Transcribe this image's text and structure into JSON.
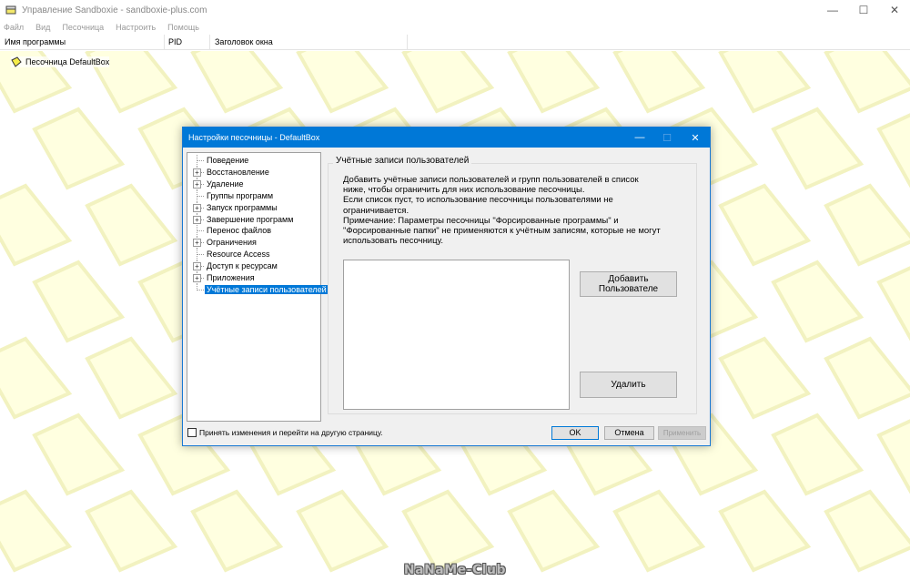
{
  "window": {
    "title": "Управление Sandboxie - sandboxie-plus.com",
    "minimize": "—",
    "maximize": "☐",
    "close": "✕"
  },
  "menu": [
    "Файл",
    "Вид",
    "Песочница",
    "Настроить",
    "Помощь"
  ],
  "columns": {
    "program_name": "Имя программы",
    "pid": "PID",
    "window_title": "Заголовок окна"
  },
  "sandbox": {
    "label": "Песочница DefaultBox"
  },
  "watermark": "NaNaMe-Club",
  "dialog": {
    "title": "Настройки песочницы - DefaultBox",
    "tree": [
      {
        "label": "Поведение",
        "expandable": false,
        "selected": false
      },
      {
        "label": "Восстановление",
        "expandable": true,
        "selected": false
      },
      {
        "label": "Удаление",
        "expandable": true,
        "selected": false
      },
      {
        "label": "Группы программ",
        "expandable": false,
        "selected": false
      },
      {
        "label": "Запуск программы",
        "expandable": true,
        "selected": false
      },
      {
        "label": "Завершение программ",
        "expandable": true,
        "selected": false
      },
      {
        "label": "Перенос файлов",
        "expandable": false,
        "selected": false
      },
      {
        "label": "Ограничения",
        "expandable": true,
        "selected": false
      },
      {
        "label": "Resource Access",
        "expandable": false,
        "selected": false
      },
      {
        "label": "Доступ к ресурсам",
        "expandable": true,
        "selected": false
      },
      {
        "label": "Приложения",
        "expandable": true,
        "selected": false
      },
      {
        "label": "Учётные записи пользователей",
        "expandable": false,
        "selected": true
      }
    ],
    "group_title": "Учётные записи пользователей",
    "description": [
      "Добавить учётные записи пользователей и групп пользователей в список",
      "ниже, чтобы ограничить для них использование песочницы.",
      "Если список пуст, то использование песочницы пользователями не",
      "ограничивается.",
      "Примечание: Параметры песочницы \"Форсированные программы\" и",
      "\"Форсированные папки\" не применяются к учётным записям, которые не могут",
      "использовать песочницу."
    ],
    "add_button": [
      "Добавить",
      "Пользователе"
    ],
    "delete_button": "Удалить",
    "checkbox_label": "Принять изменения и перейти на другую страницу.",
    "ok_button": "OK",
    "cancel_button": "Отмена",
    "apply_button": "Применить"
  },
  "colors": {
    "accent": "#0078d7",
    "pattern_fill": "#ffffe0",
    "pattern_stroke": "#f2f2c0"
  }
}
